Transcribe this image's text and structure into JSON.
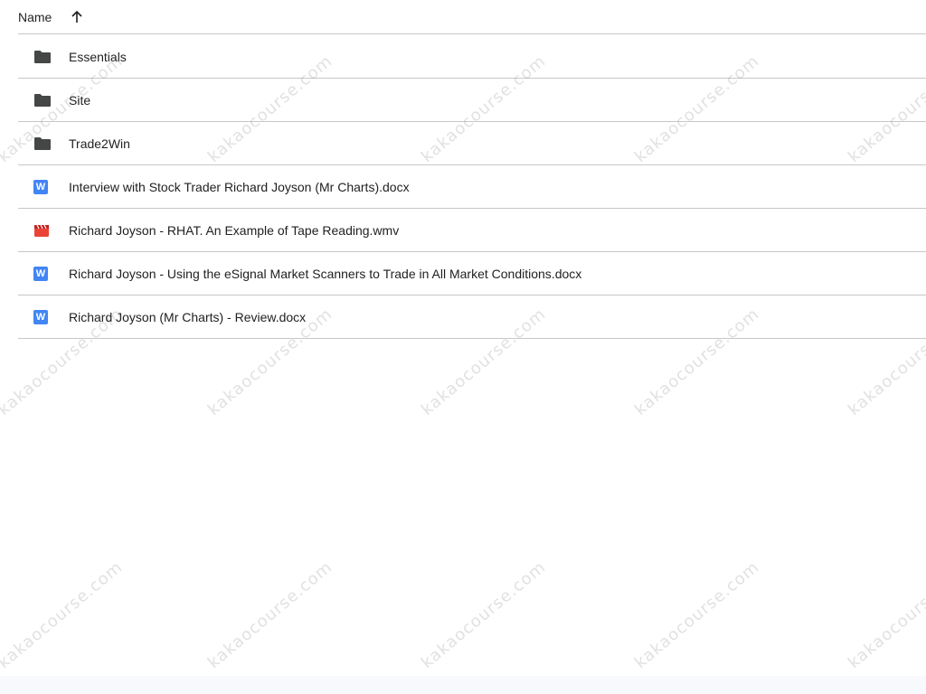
{
  "header": {
    "name_label": "Name",
    "sort_icon": "arrow-up-icon"
  },
  "files": [
    {
      "name": "Essentials",
      "type": "folder",
      "icon": "folder-icon"
    },
    {
      "name": "Site",
      "type": "folder",
      "icon": "folder-icon"
    },
    {
      "name": "Trade2Win",
      "type": "folder",
      "icon": "folder-icon"
    },
    {
      "name": "Interview with Stock Trader Richard Joyson (Mr Charts).docx",
      "type": "docx",
      "icon": "word-doc-icon",
      "badge": "W"
    },
    {
      "name": "Richard Joyson - RHAT. An Example of Tape Reading.wmv",
      "type": "video",
      "icon": "video-file-icon"
    },
    {
      "name": "Richard Joyson - Using the eSignal Market Scanners to Trade in All Market Conditions.docx",
      "type": "docx",
      "icon": "word-doc-icon",
      "badge": "W"
    },
    {
      "name": "Richard Joyson (Mr Charts) - Review.docx",
      "type": "docx",
      "icon": "word-doc-icon",
      "badge": "W"
    }
  ],
  "watermark": {
    "text": "kakaocourse.com"
  },
  "colors": {
    "folder": "#444746",
    "docx": "#4285f4",
    "video": "#ea4335",
    "divider": "#c7c7c7"
  }
}
